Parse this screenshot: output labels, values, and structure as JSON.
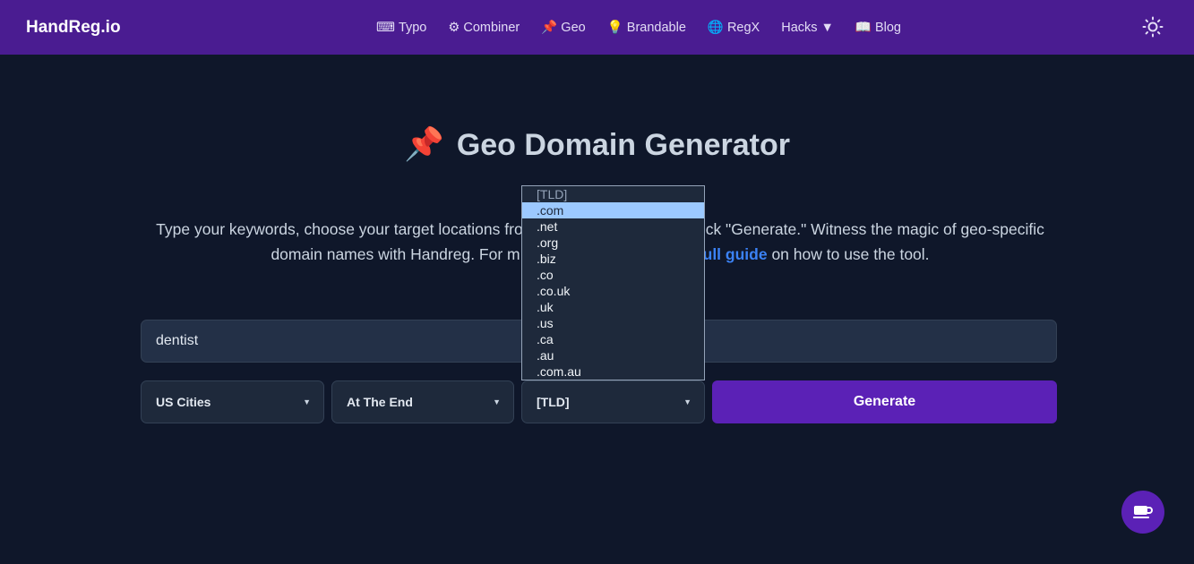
{
  "nav": {
    "logo": "HandReg.io",
    "links": [
      {
        "icon": "keyboard-icon",
        "glyph": "⌨",
        "label": "Typo"
      },
      {
        "icon": "gear-icon",
        "glyph": "⚙",
        "label": "Combiner"
      },
      {
        "icon": "pushpin-icon",
        "glyph": "📌",
        "label": "Geo"
      },
      {
        "icon": "lightbulb-icon",
        "glyph": "💡",
        "label": "Brandable"
      },
      {
        "icon": "globe-icon",
        "glyph": "🌐",
        "label": "RegX"
      },
      {
        "icon": "",
        "glyph": "",
        "label": "Hacks ▼"
      },
      {
        "icon": "book-icon",
        "glyph": "📖",
        "label": "Blog"
      }
    ]
  },
  "hero": {
    "title": "Geo Domain Generator",
    "line1_a": "Type your keywords, choose your target locations fro",
    "line1_b": "ck \"Generate.\" Witness the magic of geo-specific",
    "line2_a": "domain names with Handreg. For m",
    "line2_link": "ull guide",
    "line2_b": " on how to use the tool."
  },
  "form": {
    "keyword": "dentist",
    "location": "US Cities",
    "position": "At The End",
    "tld": "[TLD]",
    "generate": "Generate"
  },
  "tld_options": [
    "[TLD]",
    ".com",
    ".net",
    ".org",
    ".biz",
    ".co",
    ".co.uk",
    ".uk",
    ".us",
    ".ca",
    ".au",
    ".com.au"
  ],
  "tld_highlighted": ".com",
  "colors": {
    "nav": "#4a1c91",
    "bg": "#0f172a",
    "accent": "#5b21b6",
    "link": "#3b82f6"
  }
}
